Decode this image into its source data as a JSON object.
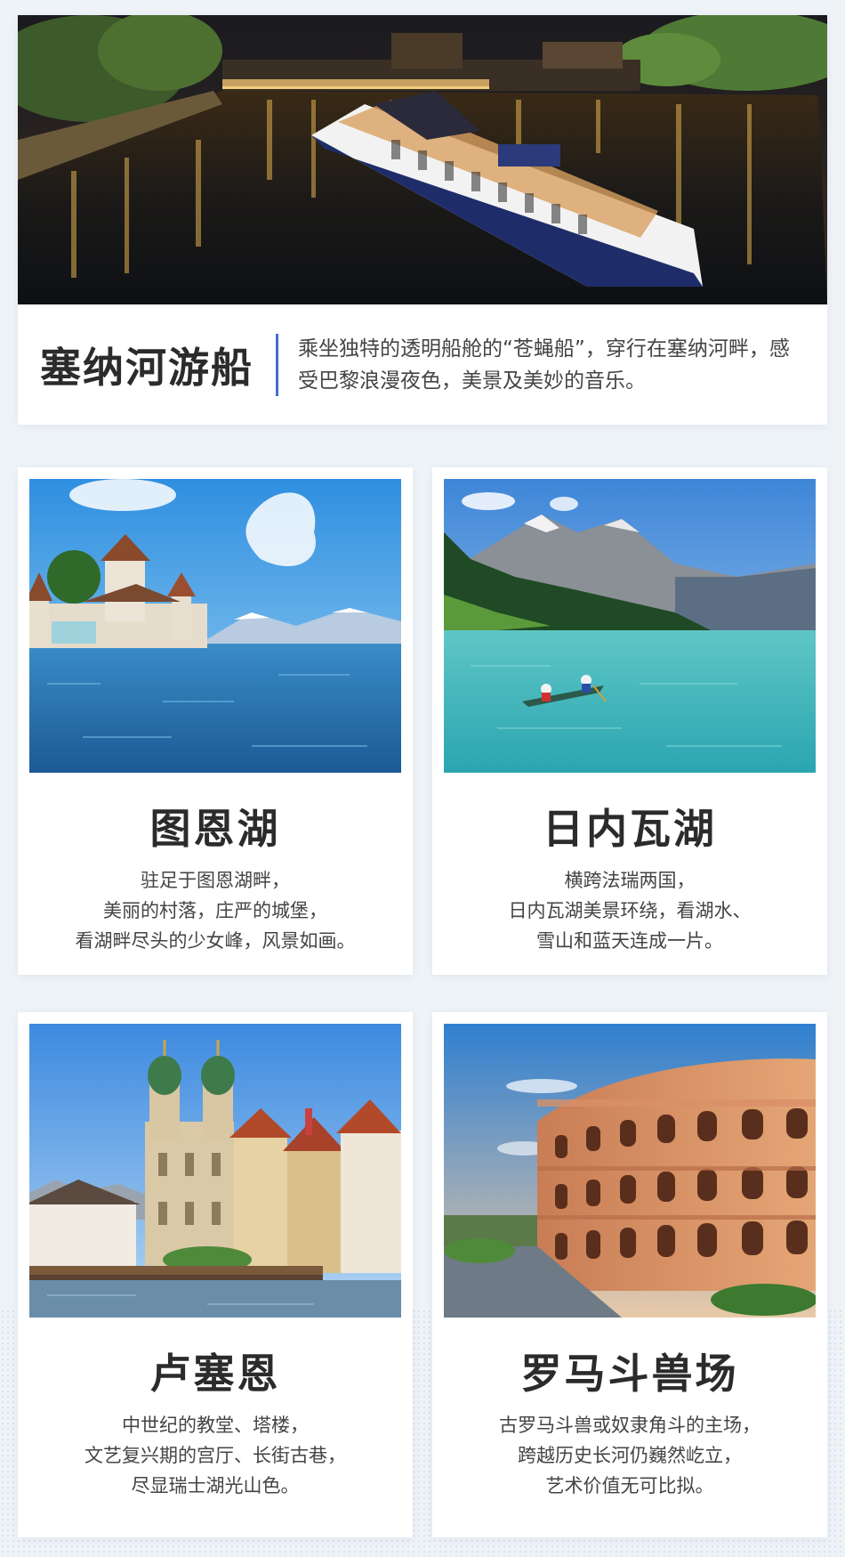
{
  "hero": {
    "title": "塞纳河游船",
    "description": "乘坐独特的透明船舱的“苍蝇船”，穿行在塞纳河畔，感受巴黎浪漫夜色，美景及美妙的音乐。"
  },
  "cards": [
    {
      "title": "图恩湖",
      "lines": [
        "驻足于图恩湖畔，",
        "美丽的村落，庄严的城堡，",
        "看湖畔尽头的少女峰，风景如画。"
      ]
    },
    {
      "title": "日内瓦湖",
      "lines": [
        "横跨法瑞两国，",
        "日内瓦湖美景环绕，看湖水、",
        "雪山和蓝天连成一片。"
      ]
    },
    {
      "title": "卢塞恩",
      "lines": [
        "中世纪的教堂、塔楼，",
        "文艺复兴期的宫厅、长街古巷，",
        "尽显瑞士湖光山色。"
      ]
    },
    {
      "title": "罗马斗兽场",
      "lines": [
        "古罗马斗兽或奴隶角斗的主场，",
        "跨越历史长河仍巍然屹立，",
        "艺术价值无可比拟。"
      ]
    }
  ],
  "colors": {
    "accent": "#3b6fd0",
    "background": "#eef3f8",
    "card": "#ffffff",
    "title_text": "#2b2b2b"
  },
  "images": [
    "seine-night-cruise-photo",
    "lake-thun-castle-photo",
    "emerald-lake-canoe-photo",
    "lucerne-church-riverside-photo",
    "roman-colosseum-photo"
  ]
}
